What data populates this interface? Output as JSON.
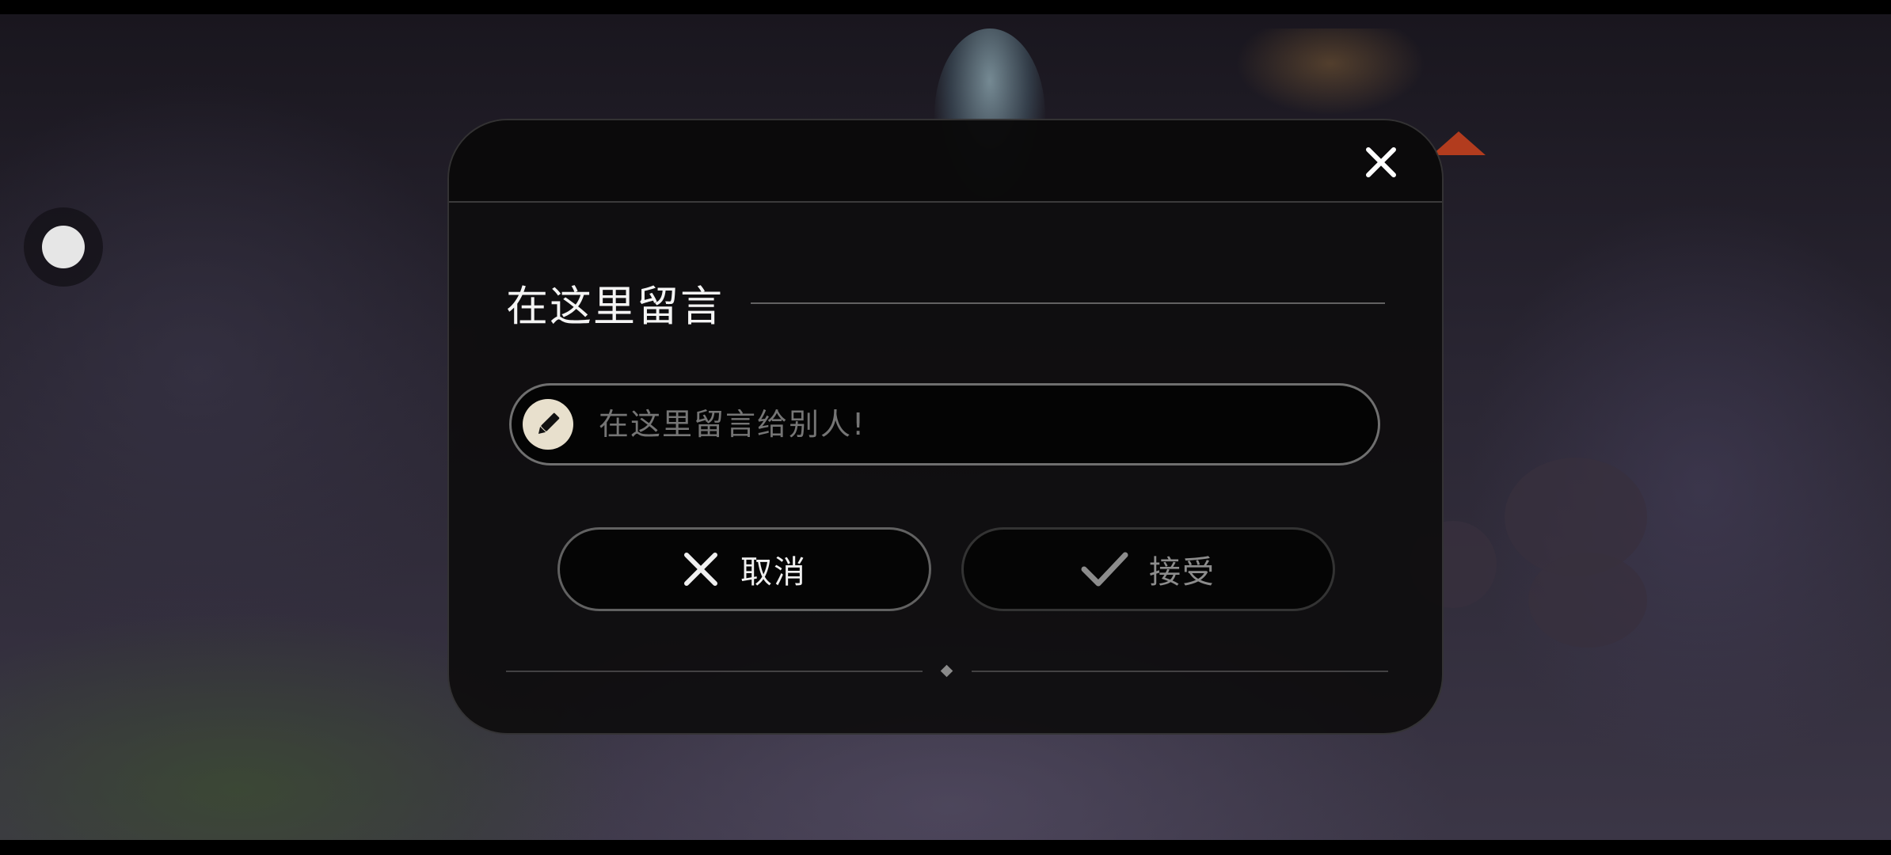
{
  "dialog": {
    "title": "在这里留言",
    "input": {
      "placeholder": "在这里留言给别人!"
    },
    "cancel_label": "取消",
    "accept_label": "接受"
  },
  "icons": {
    "close": "close-icon",
    "pencil": "pencil-icon",
    "cancel": "x-icon",
    "accept": "check-icon",
    "side_toggle": "circle-toggle-icon"
  },
  "colors": {
    "dialog_bg": "#0e0d0e",
    "title_text": "#f4f4f4",
    "placeholder_text": "#8a8a8a",
    "pencil_badge": "#e8e0cd",
    "accept_disabled_text": "#8c8c8c"
  }
}
